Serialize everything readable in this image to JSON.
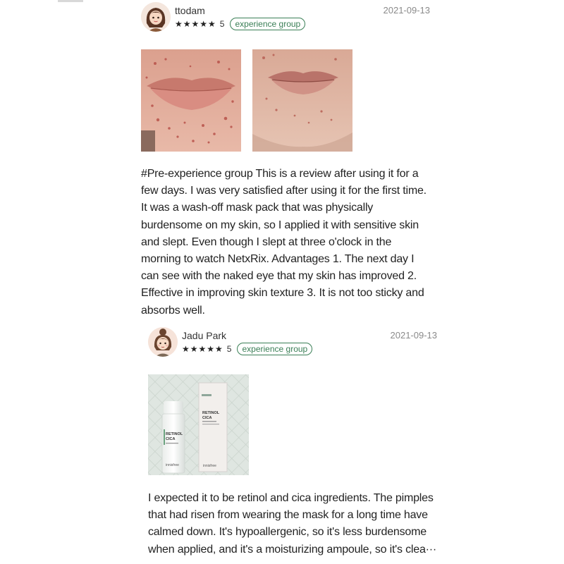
{
  "reviews": [
    {
      "username": "ttodam",
      "date": "2021-09-13",
      "stars": "★★★★★",
      "rating": "5",
      "badge": "experience group",
      "avatar_icon": "woman-avatar-icon",
      "photos": [
        {
          "desc": "before-photo-acne-chin"
        },
        {
          "desc": "after-photo-acne-chin"
        }
      ],
      "text": "#Pre-experience group This is a review after using it for a few days. I was very satisfied after using it for the first time. It was a wash-off mask pack that was physically burdensome on my skin, so I applied it with sensitive skin and slept. Even though I slept at three o'clock in the morning to watch NetxRix. Advantages 1. The next day I can see with the naked eye that my skin has improved 2. Effective in improving skin texture 3. It is not too sticky and absorbs well."
    },
    {
      "username": "Jadu Park",
      "date": "2021-09-13",
      "stars": "★★★★★",
      "rating": "5",
      "badge": "experience group",
      "avatar_icon": "girl-avatar-icon",
      "photos": [
        {
          "desc": "product-photo-retinol-cica",
          "bottle_label": [
            "RETINOL",
            "CICA"
          ],
          "box_label": [
            "RETINOL",
            "CICA"
          ],
          "brand": "innisfree"
        }
      ],
      "text": "I expected it to be retinol and cica ingredients. The pimples that had risen from wearing the mask for a long time have calmed down. It's hypoallergenic, so it's less burdensome when applied, and it's a moisturizing ampoule, so it's clea···"
    }
  ],
  "colors": {
    "badge": "#3a7f56",
    "date": "#8a8a8a",
    "text": "#222222"
  }
}
